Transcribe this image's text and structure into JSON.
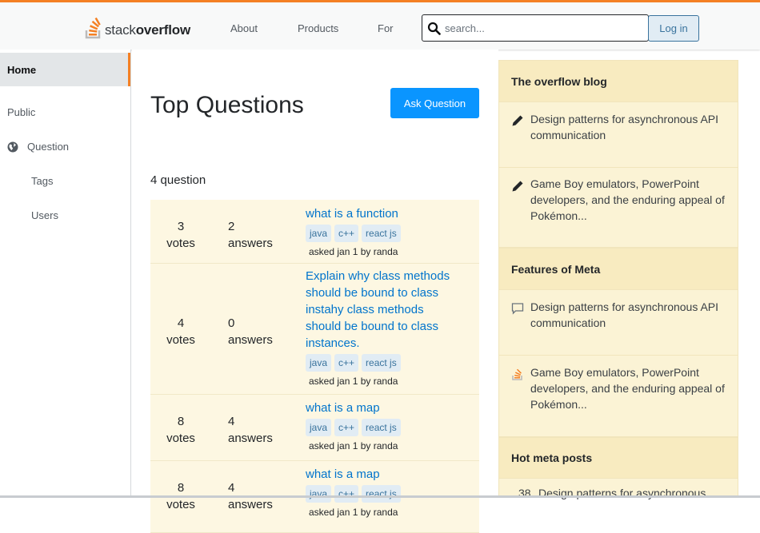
{
  "header": {
    "logo_text_light": "stack",
    "logo_text_bold": "overflow",
    "nav": [
      "About",
      "Products",
      "For"
    ],
    "search_placeholder": "search...",
    "login_label": "Log in"
  },
  "sidebar": {
    "home": "Home",
    "public": "Public",
    "question": "Question",
    "tags": "Tags",
    "users": "Users"
  },
  "main": {
    "title": "Top Questions",
    "ask_button": "Ask Question",
    "count_label": "4 question",
    "questions": [
      {
        "votes": "3",
        "votes_label": "votes",
        "answers": "2",
        "answers_label": "answers",
        "title": "what is a function",
        "tags": [
          "java",
          "c++",
          "react js"
        ],
        "asked": "asked jan 1 by randa"
      },
      {
        "votes": "4",
        "votes_label": "votes",
        "answers": "0",
        "answers_label": "answers",
        "title": "Explain why class methods should be bound to class instahy class methods should be bound to class instances.",
        "tags": [
          "java",
          "c++",
          "react js"
        ],
        "asked": "asked jan 1 by randa"
      },
      {
        "votes": "8",
        "votes_label": "votes",
        "answers": "4",
        "answers_label": "answers",
        "title": "what is a map",
        "tags": [
          "java",
          "c++",
          "react js"
        ],
        "asked": "asked jan 1 by randa"
      },
      {
        "votes": "8",
        "votes_label": "votes",
        "answers": "4",
        "answers_label": "answers",
        "title": "what is a map",
        "tags": [
          "java",
          "c++",
          "react js"
        ],
        "asked": "asked jan 1 by randa"
      }
    ]
  },
  "right": {
    "blog_heading": "The overflow blog",
    "blog_items": [
      {
        "icon": "pencil-icon",
        "text": "Design patterns for asynchronous API communication"
      },
      {
        "icon": "pencil-icon",
        "text": "Game Boy emulators, PowerPoint developers, and the enduring appeal of Pokémon..."
      }
    ],
    "meta_heading": "Features of Meta",
    "meta_items": [
      {
        "icon": "comment-icon",
        "text": "Design patterns for asynchronous API communication"
      },
      {
        "icon": "stackoverflow-icon",
        "text": "Game Boy emulators, PowerPoint developers, and the enduring appeal of Pokémon..."
      }
    ],
    "hot_heading": "Hot meta posts",
    "hot_items": [
      {
        "count": "38",
        "text": "Design patterns for asynchronous"
      }
    ]
  },
  "colors": {
    "accent": "#f48024",
    "link": "#0074cc",
    "button": "#0a95ff",
    "sidebar_bg": "#fbf3d5"
  }
}
